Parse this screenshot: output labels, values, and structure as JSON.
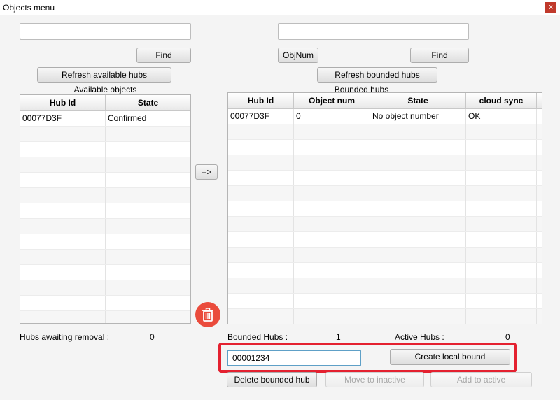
{
  "window": {
    "title": "Objects menu",
    "close_glyph": "x"
  },
  "left": {
    "search_value": "",
    "find_label": "Find",
    "refresh_label": "Refresh available hubs",
    "table_caption": "Available objects",
    "columns": [
      "Hub Id",
      "State"
    ],
    "rows": [
      [
        "00077D3F",
        "Confirmed"
      ]
    ],
    "awaiting_label": "Hubs awaiting removal :",
    "awaiting_value": "0"
  },
  "transfer": {
    "arrow_label": "-->"
  },
  "trash": {
    "icon": "trash-icon"
  },
  "right": {
    "search_value": "",
    "objnum_label": "ObjNum",
    "find_label": "Find",
    "refresh_label": "Refresh bounded hubs",
    "table_caption": "Bounded hubs",
    "columns": [
      "Hub Id",
      "Object num",
      "State",
      "cloud sync"
    ],
    "rows": [
      [
        "00077D3F",
        "0",
        "No object number",
        "OK"
      ]
    ],
    "bounded_label": "Bounded Hubs :",
    "bounded_value": "1",
    "active_label": "Active Hubs :",
    "active_value": "0"
  },
  "bound": {
    "object_number_value": "00001234",
    "create_label": "Create local bound"
  },
  "actions": {
    "delete_label": "Delete bounded hub",
    "move_label": "Move to inactive",
    "add_label": "Add to active"
  },
  "colors": {
    "highlight": "#e42130",
    "trash": "#ea4b3c",
    "focus": "#5ea0c7"
  }
}
